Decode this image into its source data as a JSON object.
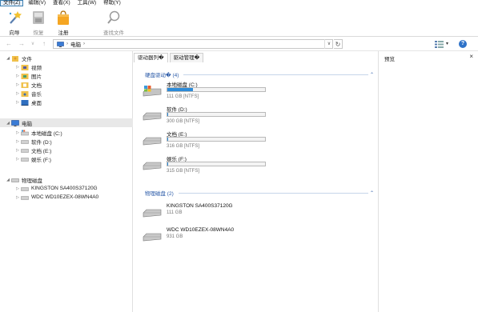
{
  "menu": [
    "文件(Z)",
    "编辑(V)",
    "查看(X)",
    "工具(W)",
    "帮助(Y)"
  ],
  "toolbar": {
    "wizard": "向导",
    "recover": "恢复",
    "register": "注册",
    "find_file": "查找文件"
  },
  "address": {
    "location": "电脑"
  },
  "tree": {
    "files": "文件",
    "files_children": [
      "视频",
      "图片",
      "文档",
      "音乐",
      "桌面"
    ],
    "computer": "电脑",
    "computer_children": [
      "本地磁盘 (C:)",
      "软件 (D:)",
      "文档 (E:)",
      "娱乐 (F:)"
    ],
    "physical": "物理磁盘",
    "physical_children": [
      "KINGSTON SA400S37120G",
      "WDC WD10EZEX-08WN4A0"
    ]
  },
  "tabs": [
    "驱动器列�",
    "驱动管理�"
  ],
  "sections": {
    "hard_drives": "硬盘驱动� (4)",
    "physical_disks": "物理磁盘 (2)"
  },
  "drives": [
    {
      "name": "本地磁盘 (C:)",
      "size": "111 GB [NTFS]",
      "used": 0.26
    },
    {
      "name": "软件 (D:)",
      "size": "300 GB [NTFS]",
      "used": 0.01
    },
    {
      "name": "文档 (E:)",
      "size": "316 GB [NTFS]",
      "used": 0.01
    },
    {
      "name": "娱乐 (F:)",
      "size": "315 GB [NTFS]",
      "used": 0.01
    }
  ],
  "disks": [
    {
      "name": "KINGSTON SA400S37120G",
      "size": "111 GB"
    },
    {
      "name": "WDC WD10EZEX-08WN4A0",
      "size": "931 GB"
    }
  ],
  "preview": {
    "title": "预览",
    "close": "×"
  },
  "colors": {
    "accent": "#2d8bd8",
    "section": "#2a5aa8"
  }
}
